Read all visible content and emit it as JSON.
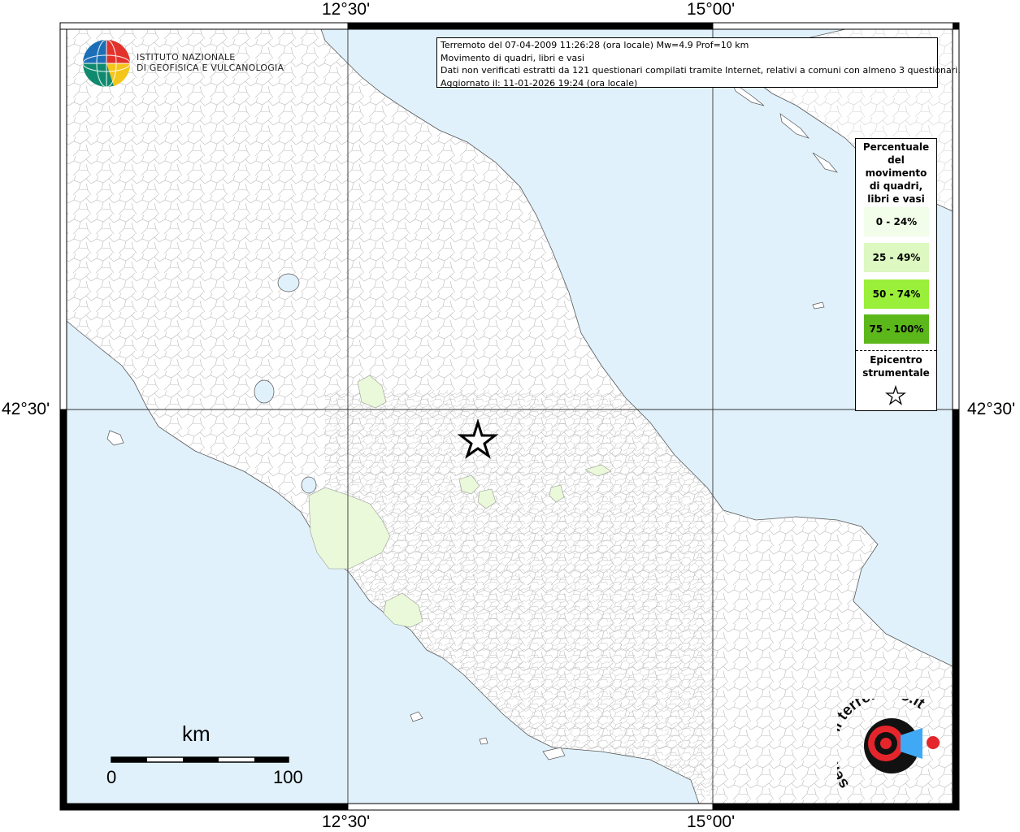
{
  "header": {
    "info_line1": "Terremoto del 07-04-2009 11:26:28 (ora locale) Mw=4.9 Prof=10 km",
    "info_line2": "Movimento di quadri, libri e vasi",
    "info_line3": "Dati non verificati estratti da 121 questionari compilati tramite Internet, relativi a comuni con almeno 3 questionari.",
    "info_line4": "Aggiornato il: 11-01-2026 19:24 (ora locale)"
  },
  "logo": {
    "line1": "ISTITUTO NAZIONALE",
    "line2": "DI GEOFISICA E VULCANOLOGIA",
    "icon": "ingv-globe-icon"
  },
  "axes": {
    "top_left": "12°30'",
    "top_right": "15°00'",
    "bottom_left": "12°30'",
    "bottom_right": "15°00'",
    "left": "42°30'",
    "right": "42°30'"
  },
  "legend": {
    "title_lines": [
      "Percentuale",
      "del",
      "movimento",
      "di quadri,",
      "libri e vasi"
    ],
    "items": [
      {
        "label": "0 - 24%",
        "color": "#f2fdea"
      },
      {
        "label": "25 - 49%",
        "color": "#ddf8c0"
      },
      {
        "label": "50 - 74%",
        "color": "#99ef3a"
      },
      {
        "label": "75 - 100%",
        "color": "#5cb81a"
      }
    ],
    "epicenter_line1": "Epicentro",
    "epicenter_line2": "strumentale"
  },
  "scale": {
    "unit": "km",
    "min_label": "0",
    "max_label": "100"
  },
  "watermark": {
    "text": "haisentitoilterremoto.it",
    "sub": "WWW"
  },
  "colors": {
    "sea": "#e0f1fb",
    "land": "#ffffff",
    "affected": "#eaf9d9",
    "border": "#000000"
  }
}
